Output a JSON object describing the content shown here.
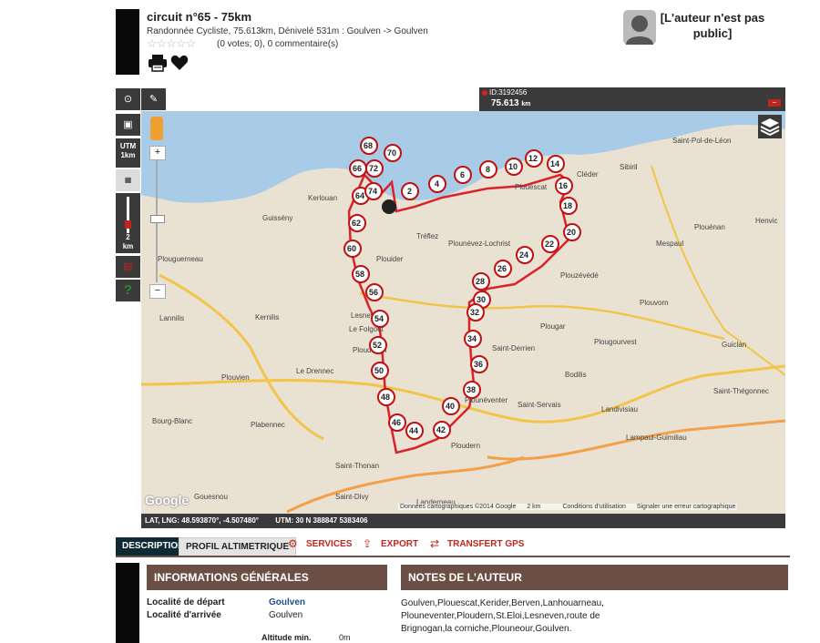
{
  "route": {
    "title": "circuit n°65 - 75km",
    "subtitle": "Randonnée Cycliste, 75.613km, Dénivelé 531m : Goulven -> Goulven",
    "stars": "☆☆☆☆☆",
    "votes": "(0 votes; 0), 0 commentaire(s)",
    "print_icon": "printer-icon",
    "fav_icon": "heart-icon"
  },
  "author": {
    "avatar_icon": "user-silhouette-icon",
    "text": "[L'auteur n'est pas public]"
  },
  "map": {
    "id_label": "ID:3192456",
    "distance": "75.613",
    "distance_unit": "km",
    "layers_icon": "layers-icon",
    "pegman_icon": "pegman-icon",
    "zoom_in": "+",
    "zoom_out": "−",
    "scale_left_top": "UTM",
    "scale_left_bottom": "1km",
    "scale2_top": "2",
    "scale2_bottom": "km",
    "help": "?",
    "google": "Google",
    "attribution": "Données cartographiques ©2014 Google",
    "scale_text": "2 km",
    "terms": "Conditions d'utilisation",
    "report": "Signaler une erreur cartographique",
    "coords": "LAT, LNG: 48.593870°, -4.507480°",
    "utm": "UTM: 30 N  388847  5383406",
    "towns": [
      "Saint-Pol-de-Léon",
      "Cléder",
      "Sibiril",
      "Plouescat",
      "Kerlouan",
      "Guissény",
      "Tréflez",
      "Plounévez-Lochrist",
      "Plouider",
      "Plouguerneau",
      "Lannilis",
      "Kernilis",
      "Lesneven",
      "Le Folgoët",
      "Plouénan",
      "Henvic",
      "Mespaul",
      "Plouzévédé",
      "Plouvorn",
      "Plougar",
      "Plougourvest",
      "Guiclan",
      "Saint-Derrien",
      "Bodilis",
      "Ploudaniel",
      "Plouvien",
      "Le Drennec",
      "Saint-Servais",
      "Landivisiau",
      "Saint-Thégonnec",
      "Bourg-Blanc",
      "Plabennec",
      "Ploudern",
      "Lampaul-Guimiliau",
      "Saint-Thonan",
      "Gouesnou",
      "Saint-Divy",
      "Landerneau",
      "Plounéventer"
    ],
    "markers": [
      "2",
      "4",
      "6",
      "8",
      "10",
      "12",
      "14",
      "16",
      "18",
      "20",
      "22",
      "24",
      "26",
      "28",
      "30",
      "32",
      "34",
      "36",
      "38",
      "40",
      "42",
      "44",
      "46",
      "48",
      "50",
      "52",
      "54",
      "56",
      "58",
      "60",
      "62",
      "64",
      "66",
      "68",
      "70",
      "72",
      "74"
    ]
  },
  "tabs": [
    "DESCRIPTION",
    "PROFIL ALTIMETRIQUE"
  ],
  "actions": [
    "SERVICES",
    "EXPORT",
    "TRANSFERT GPS"
  ],
  "info": {
    "header": "INFORMATIONS GÉNÉRALES",
    "start_label": "Localité de départ",
    "start_value": "Goulven",
    "end_label": "Localité d'arrivée",
    "end_value": "Goulven",
    "alt_label": "Altitude min.",
    "alt_value": "0m"
  },
  "notes": {
    "header": "NOTES DE L'AUTEUR",
    "text": "Goulven,Plouescat,Kerider,Berven,Lanhouarneau, Plouneventer,Ploudern,St.Eloi,Lesneven,route de Brignogan,la corniche,Plouneour,Goulven."
  },
  "colors": {
    "accent": "#c0261d",
    "section_header": "#6b4e44",
    "active_tab": "#0d2a35",
    "route": "#d9232a"
  }
}
